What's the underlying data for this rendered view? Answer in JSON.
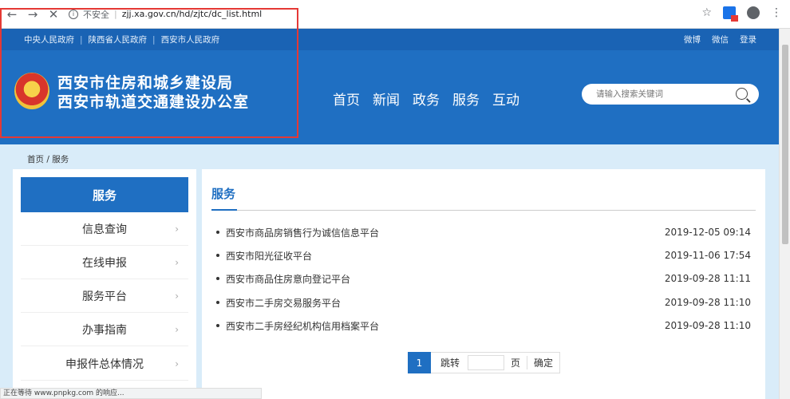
{
  "browser": {
    "insecure_label": "不安全",
    "separator": "|",
    "url": "zjj.xa.gov.cn/hd/zjtc/dc_list.html"
  },
  "topbar": {
    "links": [
      "中央人民政府",
      "陕西省人民政府",
      "西安市人民政府"
    ],
    "divider": "|",
    "right_links": [
      "微博",
      "微信",
      "登录"
    ]
  },
  "org": {
    "line1": "西安市住房和城乡建设局",
    "line2": "西安市轨道交通建设办公室"
  },
  "nav": [
    "首页",
    "新闻",
    "政务",
    "服务",
    "互动"
  ],
  "search": {
    "placeholder": "请输入搜索关键词"
  },
  "breadcrumb": "首页 /  服务",
  "sidebar": {
    "title": "服务",
    "items": [
      "信息查询",
      "在线申报",
      "服务平台",
      "办事指南",
      "申报件总体情况"
    ]
  },
  "panel": {
    "title": "服务",
    "news": [
      {
        "title": "西安市商品房销售行为诚信信息平台",
        "date": "2019-12-05 09:14"
      },
      {
        "title": "西安市阳光征收平台",
        "date": "2019-11-06 17:54"
      },
      {
        "title": "西安市商品住房意向登记平台",
        "date": "2019-09-28 11:11"
      },
      {
        "title": "西安市二手房交易服务平台",
        "date": "2019-09-28 11:10"
      },
      {
        "title": "西安市二手房经纪机构信用档案平台",
        "date": "2019-09-28 11:10"
      }
    ]
  },
  "pager": {
    "current": "1",
    "jump_label": "跳转",
    "unit": "页",
    "confirm": "确定"
  },
  "status": "正在等待 www.pnpkg.com 的响应..."
}
